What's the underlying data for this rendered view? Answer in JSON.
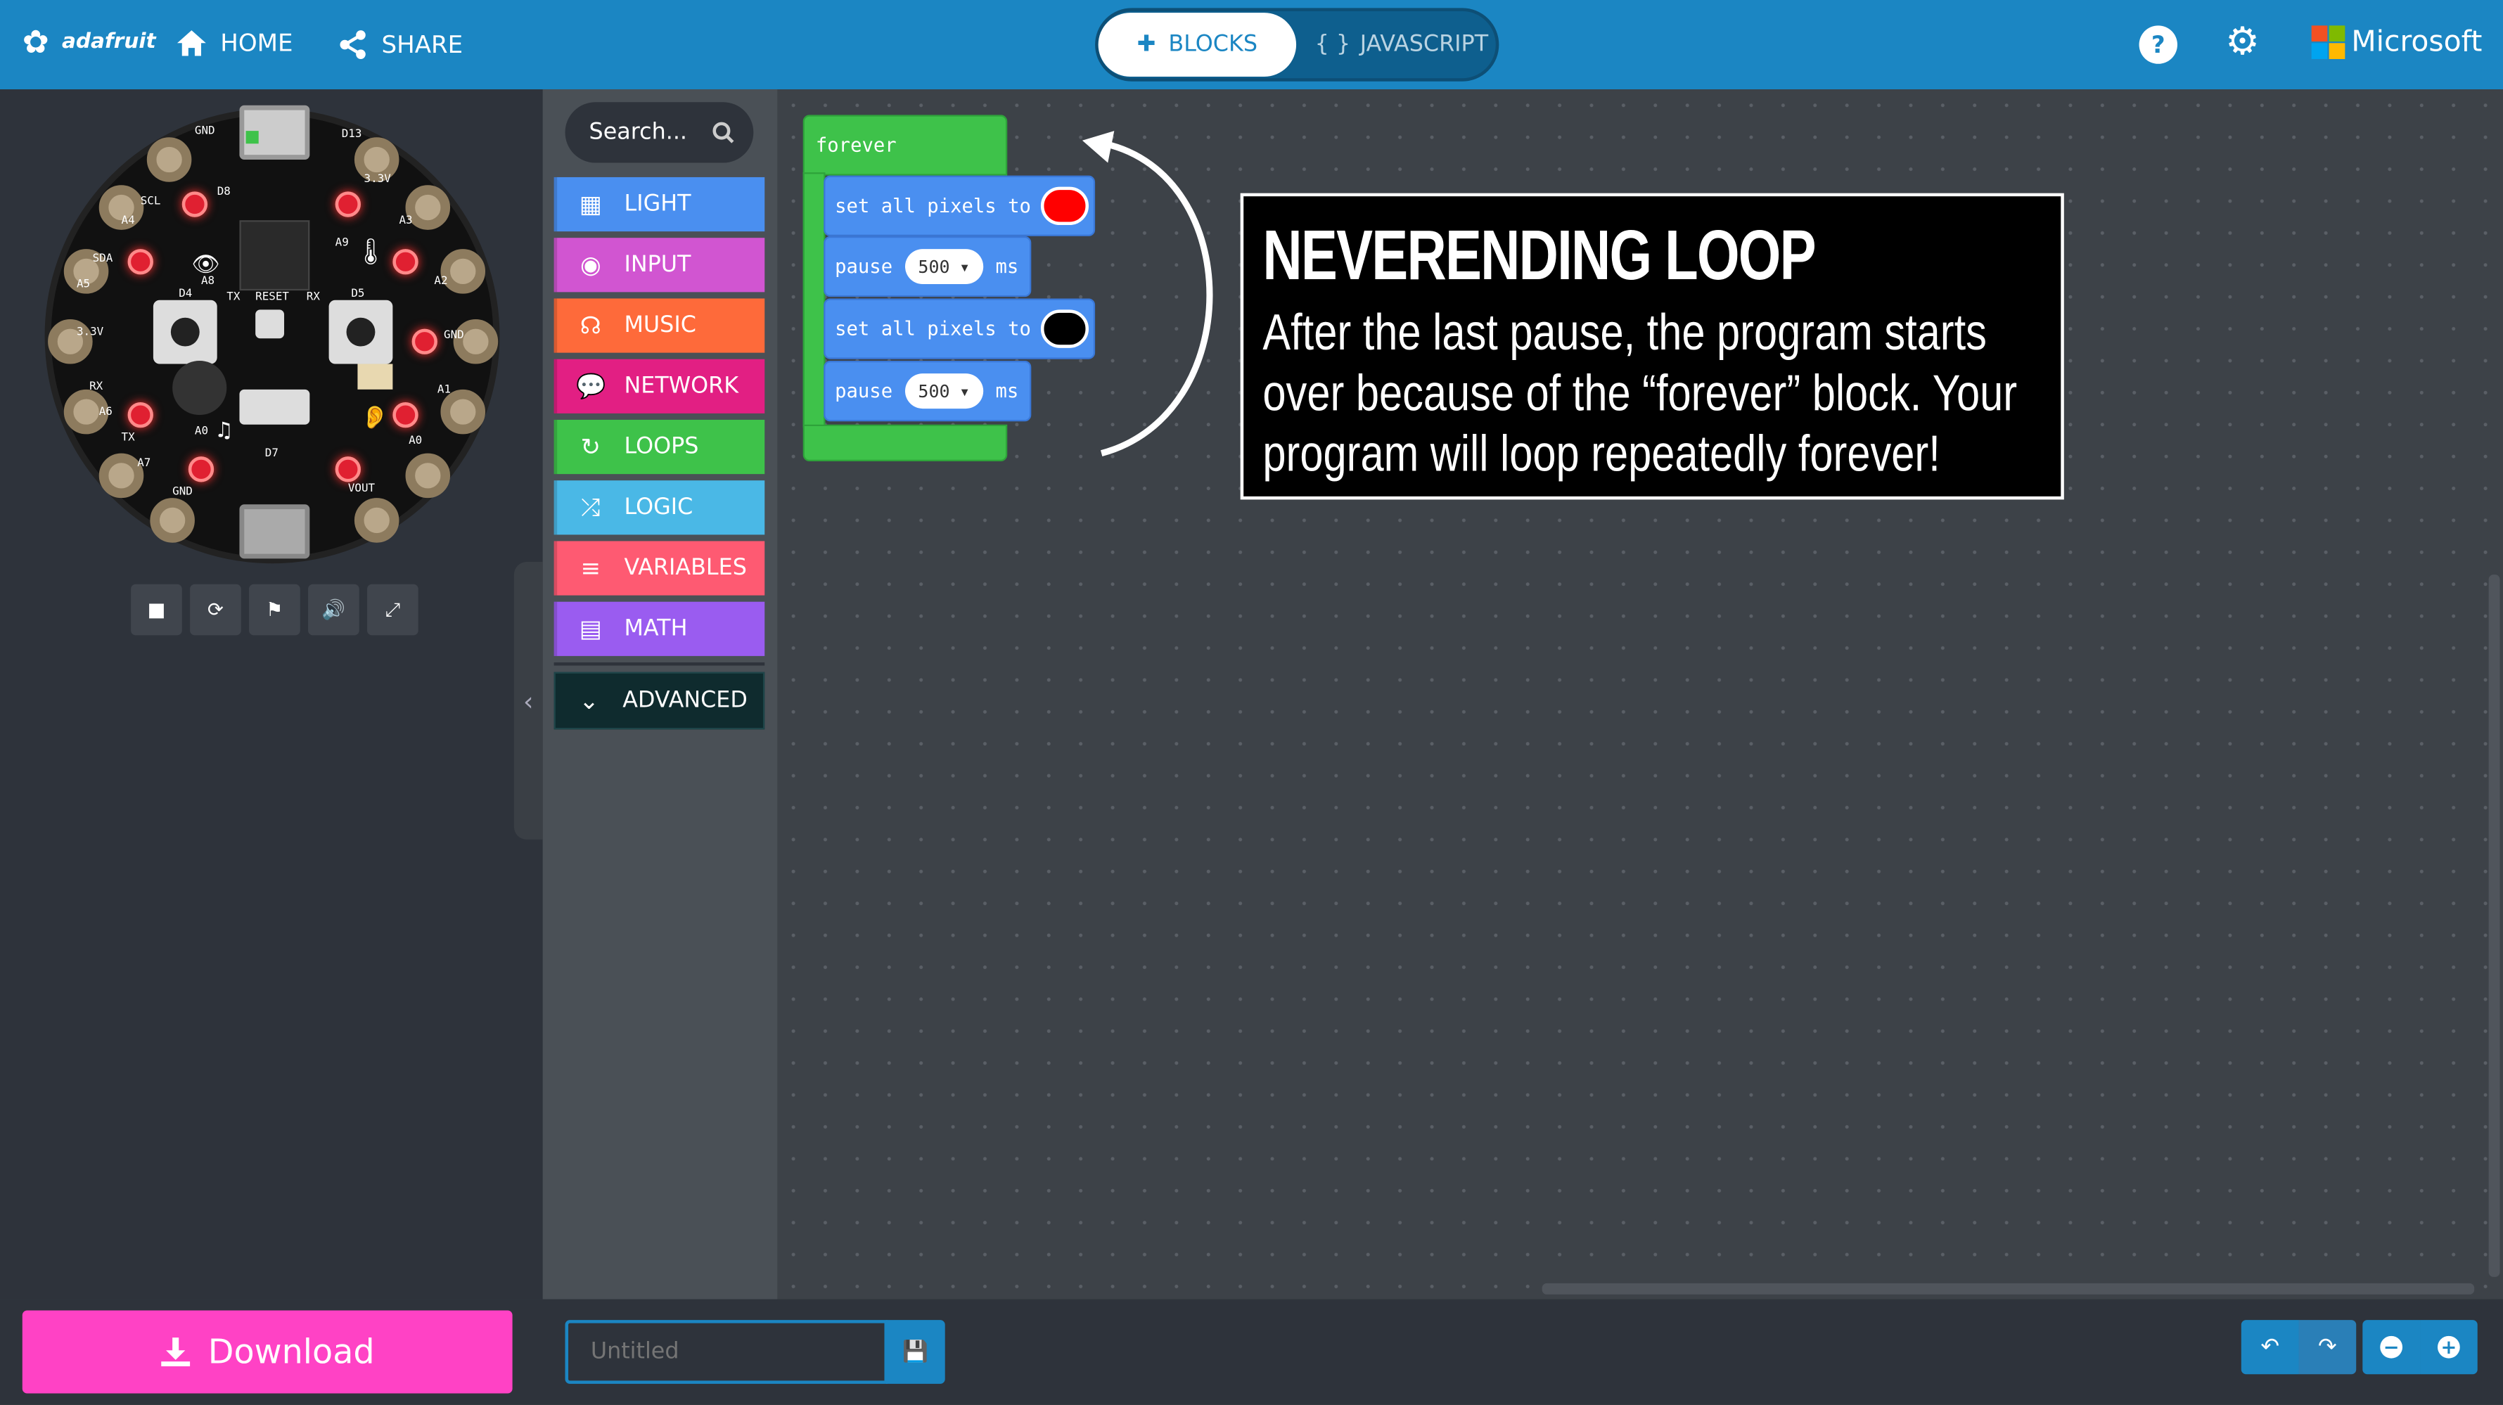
{
  "header": {
    "brand": "adafruit",
    "home_label": "HOME",
    "share_label": "SHARE",
    "tab_blocks": "BLOCKS",
    "tab_javascript": "JAVASCRIPT",
    "microsoft_label": "Microsoft",
    "js_glyph": "{ }"
  },
  "board_labels": {
    "gnd_top": "GND",
    "d13": "D13",
    "d8": "D8",
    "scl": "SCL",
    "a4": "A4",
    "v33_top": "3.3V",
    "a3": "A3",
    "sda": "SDA",
    "a5": "A5",
    "a9": "A9",
    "a8": "A8",
    "a2": "A2",
    "v33_left": "3.3V",
    "d4": "D4",
    "tx_mid": "TX",
    "reset": "RESET",
    "rx_mid": "RX",
    "d5": "D5",
    "gnd_right": "GND",
    "rx": "RX",
    "a6": "A6",
    "a1": "A1",
    "tx": "TX",
    "a7": "A7",
    "a0": "A0",
    "d7": "D7",
    "a0b": "A0",
    "gnd_bottom": "GND",
    "vout": "VOUT"
  },
  "toolbox": {
    "search_placeholder": "Search...",
    "categories": [
      {
        "label": "LIGHT",
        "color": "#4a8ff0"
      },
      {
        "label": "INPUT",
        "color": "#d155d1"
      },
      {
        "label": "MUSIC",
        "color": "#fe6a3a"
      },
      {
        "label": "NETWORK",
        "color": "#e21f83"
      },
      {
        "label": "LOOPS",
        "color": "#3ec24a"
      },
      {
        "label": "LOGIC",
        "color": "#4ab8e6"
      },
      {
        "label": "VARIABLES",
        "color": "#fe5a72"
      },
      {
        "label": "MATH",
        "color": "#9a5cf0"
      }
    ],
    "advanced_label": "ADVANCED"
  },
  "blocks": {
    "forever": "forever",
    "set_pixels_1": "set all pixels to",
    "color_1": "#ff0000",
    "pause_1": "pause",
    "pause_1_value": "500",
    "ms_1": "ms",
    "set_pixels_2": "set all pixels to",
    "color_2": "#000000",
    "pause_2": "pause",
    "pause_2_value": "500",
    "ms_2": "ms"
  },
  "callout": {
    "title": "NEVERENDING LOOP",
    "body": "After the last pause, the program starts over because of the “forever” block. Your program will loop repeatedly forever!"
  },
  "footer": {
    "download_label": "Download",
    "project_placeholder": "Untitled"
  },
  "colors": {
    "header_blue": "#1b86c3",
    "download_pink": "#ff42c5",
    "workspace": "#3d4248"
  }
}
